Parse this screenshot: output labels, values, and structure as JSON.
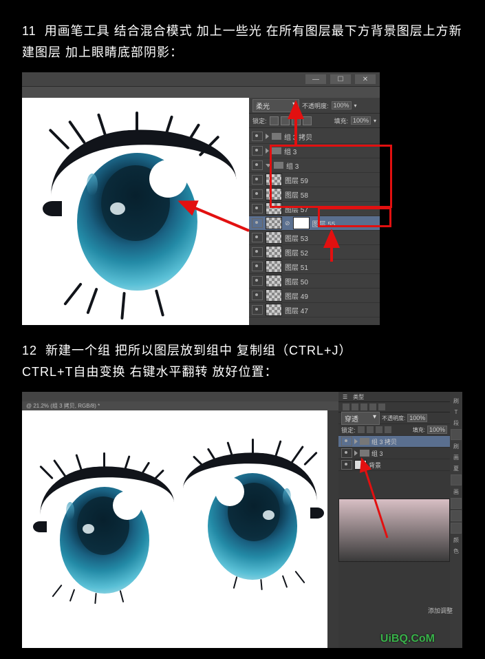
{
  "step11": {
    "num": "11",
    "text_line1": "用画笔工具  结合混合模式  加上一些光  在所有图层最下方背景图层上方新建图层  加上眼睛底部阴影：",
    "blend_mode": "柔光",
    "opacity_label": "不透明度:",
    "opacity_value": "100%",
    "lock_label": "锁定:",
    "fill_label": "填充:",
    "fill_value": "100%",
    "groups": [
      {
        "name": "组 3 拷贝"
      },
      {
        "name": "组 3"
      },
      {
        "name": "组 3"
      }
    ],
    "layers": [
      {
        "name": "图层 59"
      },
      {
        "name": "图层 58"
      },
      {
        "name": "图层 57"
      },
      {
        "name": "图层 55",
        "selected": true,
        "mask": true
      },
      {
        "name": "图层 53"
      },
      {
        "name": "图层 52"
      },
      {
        "name": "图层 51"
      },
      {
        "name": "图层 50"
      },
      {
        "name": "图层 49"
      },
      {
        "name": "图层 47"
      }
    ]
  },
  "step12": {
    "num": "12",
    "text_line1": "新建一个组  把所以图层放到组中  复制组（CTRL+J）",
    "text_line2": "CTRL+T自由变换  右键水平翻转  放好位置：",
    "doc_title": "@ 21.2% (组 3 拷贝, RGB/8) *",
    "panel_tabs": "类型",
    "blend_mode": "穿透",
    "opacity_label": "不透明度:",
    "opacity_value": "100%",
    "lock_label": "锁定:",
    "fill_label": "填充:",
    "fill_value": "100%",
    "layers": [
      {
        "name": "组 3 拷贝",
        "selected": true
      },
      {
        "name": "组 3"
      },
      {
        "name": "背景"
      }
    ],
    "add_adjust": "添加调整",
    "side_tabs": {
      "a": "刷",
      "b": "T",
      "c": "段",
      "d": "刷",
      "e": "画",
      "f": "夏",
      "g": "画",
      "h": "颜",
      "i": "色"
    }
  },
  "watermark": "UiBQ.CoM"
}
